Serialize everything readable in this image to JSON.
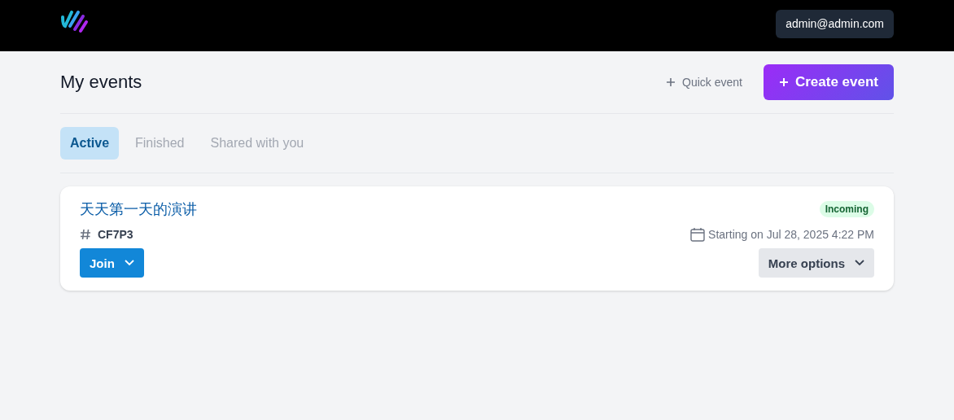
{
  "header": {
    "user": "admin@admin.com"
  },
  "page": {
    "title": "My events",
    "quick_action": "Quick event",
    "primary_action": "Create event"
  },
  "tabs": [
    {
      "label": "Active",
      "selected": true
    },
    {
      "label": "Finished",
      "selected": false
    },
    {
      "label": "Shared with you",
      "selected": false
    }
  ],
  "events": [
    {
      "title": "天天第一天的演讲",
      "code": "CF7P3",
      "status": "Incoming",
      "start": "Starting on Jul 28, 2025 4:22 PM",
      "join": "Join",
      "more": "More options"
    }
  ]
}
